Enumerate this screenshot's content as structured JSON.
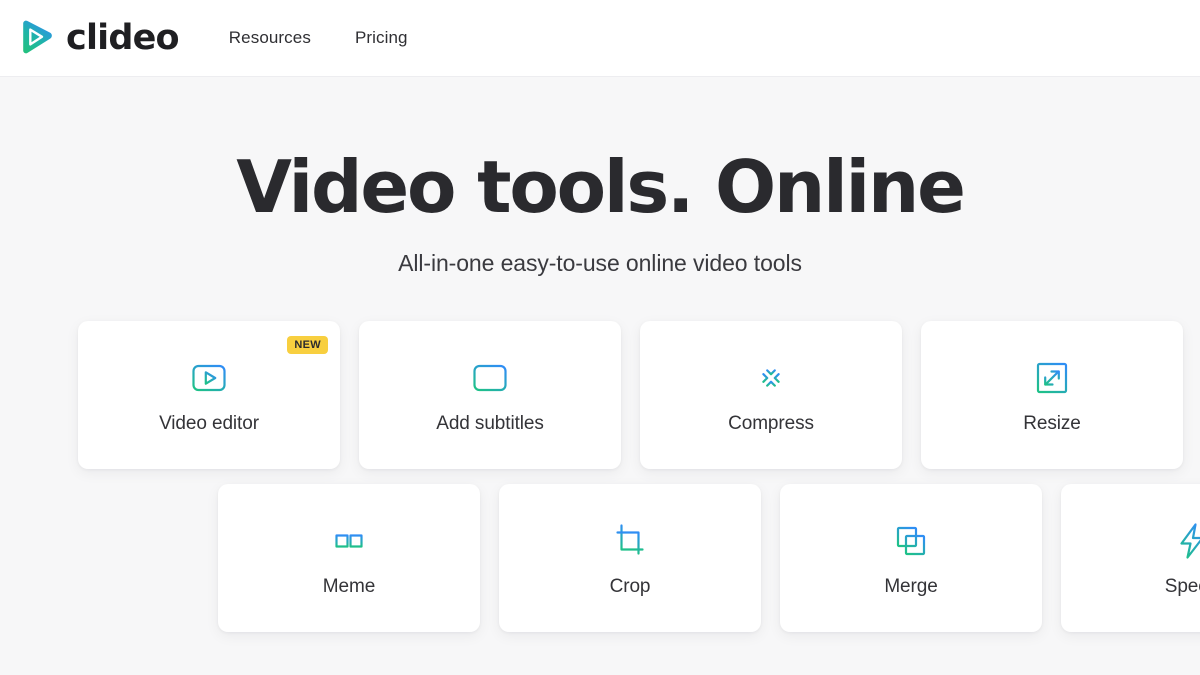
{
  "header": {
    "brand": {
      "name": "clideo",
      "logo_icon": "clideo-play-logo"
    },
    "nav": [
      {
        "label": "Resources"
      },
      {
        "label": "Pricing"
      }
    ]
  },
  "hero": {
    "title": "Video tools. Online",
    "subtitle": "All-in-one easy-to-use online video tools"
  },
  "tools": {
    "rows": [
      {
        "cards": [
          {
            "label": "Video editor",
            "icon": "video-player-icon",
            "badge": "NEW"
          },
          {
            "label": "Add subtitles",
            "icon": "subtitles-icon",
            "badge": null
          },
          {
            "label": "Compress",
            "icon": "compress-arrows-icon",
            "badge": null
          },
          {
            "label": "Resize",
            "icon": "resize-diagonal-arrows-icon",
            "badge": null
          }
        ]
      },
      {
        "cards": [
          {
            "label": "Meme",
            "icon": "glasses-icon",
            "badge": null
          },
          {
            "label": "Crop",
            "icon": "crop-icon",
            "badge": null
          },
          {
            "label": "Merge",
            "icon": "overlapping-squares-icon",
            "badge": null
          },
          {
            "label": "Speed",
            "icon": "lightning-bolt-icon",
            "badge": null
          }
        ]
      }
    ]
  },
  "colors": {
    "gradient_start": "#2f8ef4",
    "gradient_end": "#1fc08a",
    "badge_bg": "#f8cf3f",
    "page_bg": "#f7f7f8",
    "card_bg": "#ffffff",
    "text": "#2c2c30"
  }
}
